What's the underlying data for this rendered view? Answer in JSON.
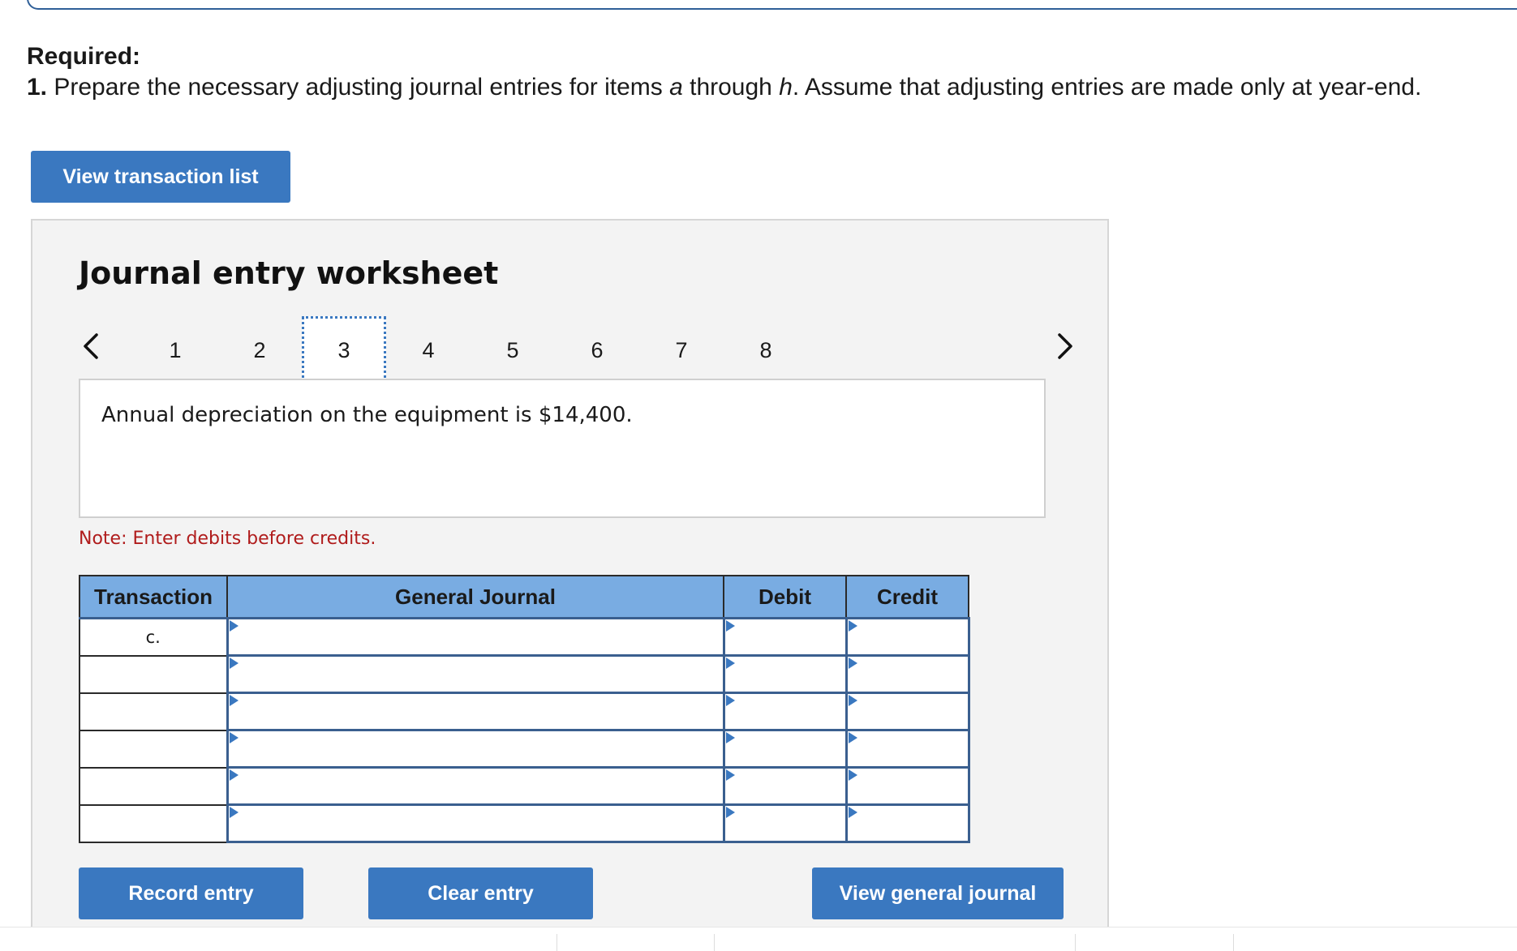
{
  "required": {
    "title": "Required:",
    "number": "1.",
    "text_before_a": " Prepare the necessary adjusting journal entries for items ",
    "item_a": "a",
    "text_between": " through ",
    "item_h": "h",
    "text_after": ". Assume that adjusting entries are made only at year-end."
  },
  "buttons": {
    "view_transaction_list": "View transaction list",
    "record_entry": "Record entry",
    "clear_entry": "Clear entry",
    "view_general_journal": "View general journal"
  },
  "worksheet": {
    "title": "Journal entry worksheet",
    "pages": [
      "1",
      "2",
      "3",
      "4",
      "5",
      "6",
      "7",
      "8"
    ],
    "active_page": "3",
    "description": "Annual depreciation on the equipment is $14,400.",
    "note": "Note: Enter debits before credits."
  },
  "table": {
    "headers": {
      "transaction": "Transaction",
      "general_journal": "General Journal",
      "debit": "Debit",
      "credit": "Credit"
    },
    "rows": [
      {
        "transaction": "c.",
        "account": "",
        "debit": "",
        "credit": ""
      },
      {
        "transaction": "",
        "account": "",
        "debit": "",
        "credit": ""
      },
      {
        "transaction": "",
        "account": "",
        "debit": "",
        "credit": ""
      },
      {
        "transaction": "",
        "account": "",
        "debit": "",
        "credit": ""
      },
      {
        "transaction": "",
        "account": "",
        "debit": "",
        "credit": ""
      },
      {
        "transaction": "",
        "account": "",
        "debit": "",
        "credit": ""
      }
    ]
  },
  "icons": {
    "prev": "chevron-left-icon",
    "next": "chevron-right-icon",
    "cell_marker": "triangle-flag-icon"
  },
  "colors": {
    "button": "#3a78c0",
    "header": "#79ace2",
    "note": "#b01c1c",
    "panel": "#f3f3f3"
  }
}
